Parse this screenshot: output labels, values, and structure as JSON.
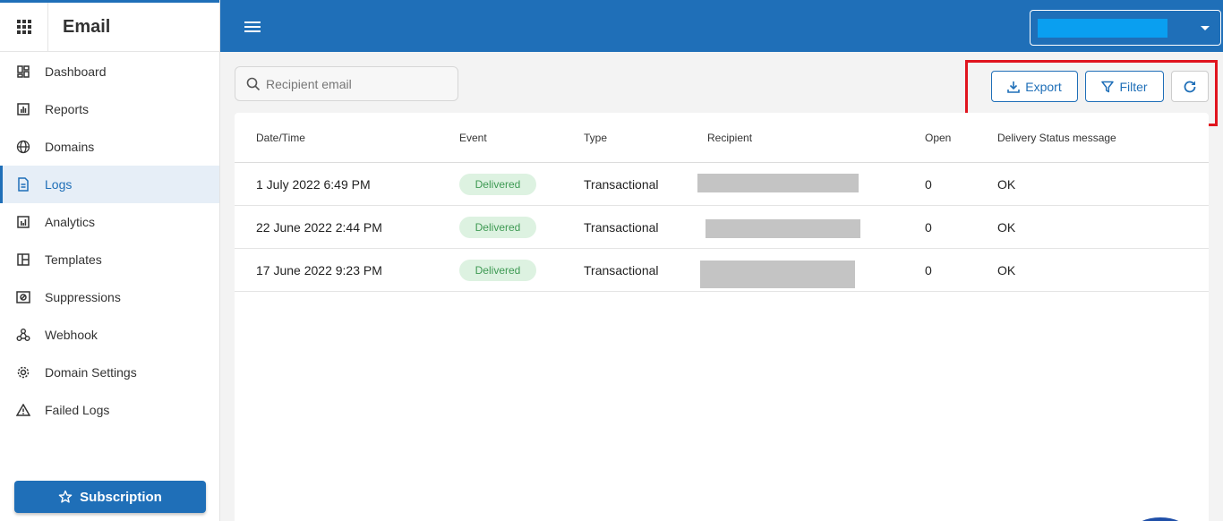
{
  "app": {
    "title": "Email"
  },
  "topbar": {
    "account_name": ""
  },
  "sidebar": {
    "items": [
      {
        "label": "Dashboard",
        "icon": "dashboard-icon"
      },
      {
        "label": "Reports",
        "icon": "reports-icon"
      },
      {
        "label": "Domains",
        "icon": "globe-icon"
      },
      {
        "label": "Logs",
        "icon": "document-icon",
        "active": true
      },
      {
        "label": "Analytics",
        "icon": "bar-chart-icon"
      },
      {
        "label": "Templates",
        "icon": "template-icon"
      },
      {
        "label": "Suppressions",
        "icon": "suppression-icon"
      },
      {
        "label": "Webhook",
        "icon": "webhook-icon"
      },
      {
        "label": "Domain Settings",
        "icon": "gear-icon"
      },
      {
        "label": "Failed Logs",
        "icon": "warning-icon"
      }
    ],
    "subscription_label": "Subscription"
  },
  "search": {
    "placeholder": "Recipient email",
    "value": ""
  },
  "toolbar": {
    "export_label": "Export",
    "filter_label": "Filter"
  },
  "table": {
    "headers": [
      "Date/Time",
      "Event",
      "Type",
      "Recipient",
      "Open",
      "Delivery Status message"
    ],
    "rows": [
      {
        "datetime": "1 July 2022 6:49 PM",
        "event": "Delivered",
        "type": "Transactional",
        "recipient": "",
        "open": "0",
        "status": "OK"
      },
      {
        "datetime": "22 June 2022 2:44 PM",
        "event": "Delivered",
        "type": "Transactional",
        "recipient": "",
        "open": "0",
        "status": "OK"
      },
      {
        "datetime": "17 June 2022 9:23 PM",
        "event": "Delivered",
        "type": "Transactional",
        "recipient": "",
        "open": "0",
        "status": "OK"
      }
    ]
  },
  "colors": {
    "primary": "#1f6fb8",
    "highlight": "#e0141e",
    "badge_bg": "#ddf2e1",
    "badge_text": "#3e9a53"
  }
}
